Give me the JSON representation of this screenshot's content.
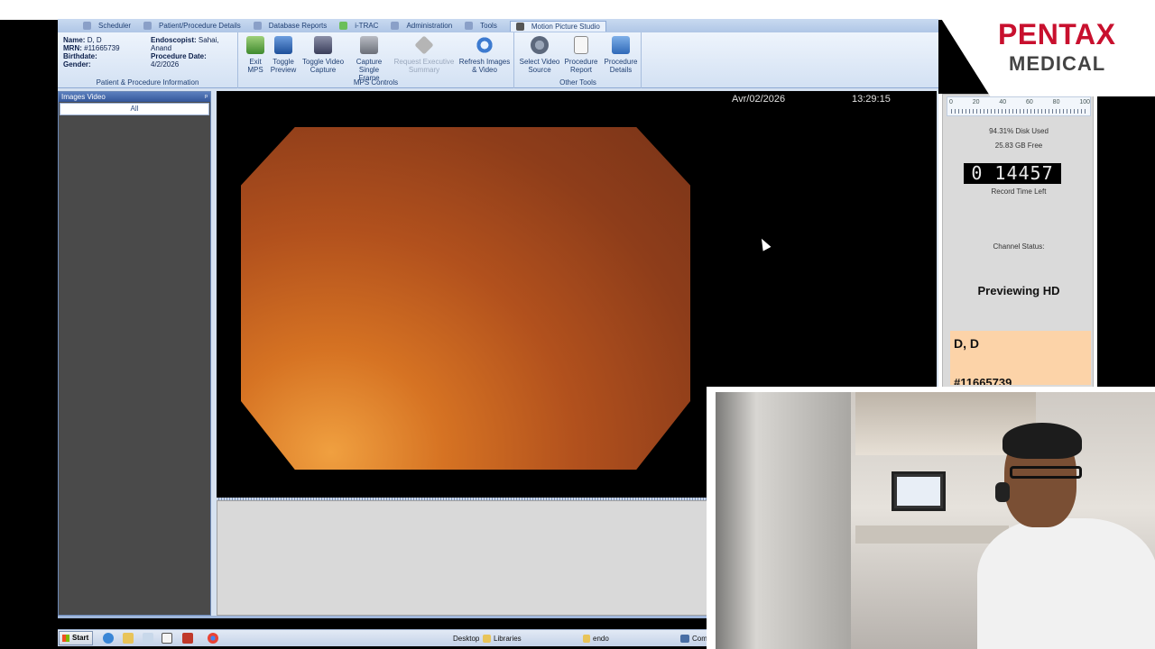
{
  "branding": {
    "line1": "PENTAX",
    "line2": "MEDICAL"
  },
  "tabs": [
    {
      "label": "Scheduler",
      "icon": "calendar-icon"
    },
    {
      "label": "Patient/Procedure Details",
      "icon": "patient-icon"
    },
    {
      "label": "Database Reports",
      "icon": "database-icon"
    },
    {
      "label": "i-TRAC",
      "icon": "itrac-icon"
    },
    {
      "label": "Administration",
      "icon": "gear-icon"
    },
    {
      "label": "Tools",
      "icon": "tools-icon"
    },
    {
      "label": "Motion Picture Studio",
      "icon": "camera-icon"
    }
  ],
  "patient_info": {
    "name_label": "Name:",
    "name": "D, D",
    "mrn_label": "MRN:",
    "mrn": "#11665739",
    "birthdate_label": "Birthdate:",
    "birthdate": "",
    "gender_label": "Gender:",
    "gender": "",
    "endoscopist_label": "Endoscopist:",
    "endoscopist_line1": "Sahai,",
    "endoscopist_line2": "Anand",
    "procedure_date_label": "Procedure Date:",
    "procedure_date": "4/2/2026",
    "group_label": "Patient & Procedure Information"
  },
  "mps_controls": {
    "group_label": "MPS Controls",
    "buttons": [
      {
        "line1": "Exit",
        "line2": "MPS",
        "icon": "exit-icon"
      },
      {
        "line1": "Toggle",
        "line2": "Preview",
        "icon": "monitor-icon"
      },
      {
        "line1": "Toggle Video",
        "line2": "Capture",
        "icon": "video-camera-icon"
      },
      {
        "line1": "Capture",
        "line2": "Single Frame",
        "icon": "photo-camera-icon"
      },
      {
        "line1": "Request Executive",
        "line2": "Summary",
        "icon": "summary-icon"
      },
      {
        "line1": "Refresh Images",
        "line2": "& Video",
        "icon": "refresh-icon"
      }
    ]
  },
  "other_tools": {
    "group_label": "Other Tools",
    "buttons": [
      {
        "line1": "Select Video",
        "line2": "Source",
        "icon": "video-source-icon"
      },
      {
        "line1": "Procedure",
        "line2": "Report",
        "icon": "report-icon"
      },
      {
        "line1": "Procedure",
        "line2": "Details",
        "icon": "details-icon"
      }
    ]
  },
  "images_pane": {
    "title": "Images Video",
    "pin": "ᵖ",
    "filter": "All"
  },
  "video": {
    "date": "Avr/02/2026",
    "time": "13:29:15"
  },
  "status_panel": {
    "ruler_labels": [
      "0",
      "20",
      "40",
      "60",
      "80",
      "100"
    ],
    "disk_used": "94.31% Disk Used",
    "disk_free": "25.83 GB Free",
    "record_time": "0 14457",
    "record_time_label": "Record Time Left",
    "channel_status_label": "Channel Status:",
    "mode": "Previewing HD",
    "patient_name": "D, D",
    "patient_mrn": "#11665739"
  },
  "taskbar": {
    "start": "Start",
    "desktop": "Desktop",
    "libraries": "Libraries",
    "endo": "endo",
    "computer": "Comput"
  }
}
